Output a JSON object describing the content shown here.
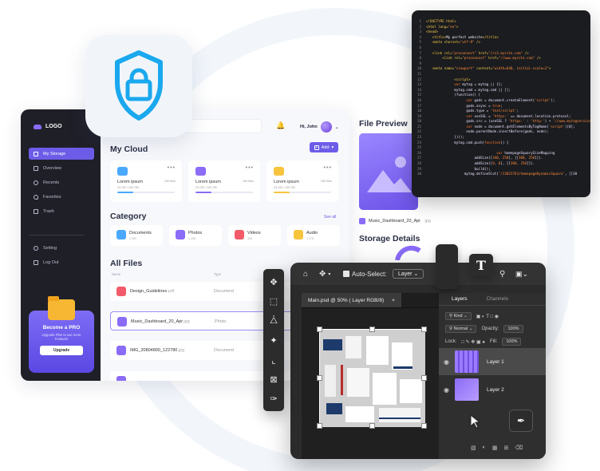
{
  "storage": {
    "logo": "LOGO",
    "nav": [
      {
        "label": "My Storage"
      },
      {
        "label": "Overview"
      },
      {
        "label": "Recents"
      },
      {
        "label": "Favorites"
      },
      {
        "label": "Trash"
      }
    ],
    "nav_bottom": [
      {
        "label": "Setting"
      },
      {
        "label": "Log Out"
      }
    ],
    "promo": {
      "title": "Become a PRO",
      "subtitle": "Upgrade Plan to use more Features",
      "button": "Upgrade"
    },
    "user_greeting": "Hi, John",
    "my_cloud_title": "My Cloud",
    "add_label": "Add",
    "cloud_cards": [
      {
        "name": "Lorem ipsum",
        "files": "150 files",
        "size": "23 GB / 100 GB",
        "progress": 0.28,
        "color": "#4aa8ff"
      },
      {
        "name": "Lorem ipsum",
        "files": "150 files",
        "size": "23 GB / 100 GB",
        "progress": 0.28,
        "color": "#8a6cf7"
      },
      {
        "name": "Lorem ipsum",
        "files": "150 files",
        "size": "23 GB / 100 GB",
        "progress": 0.28,
        "color": "#f7c43d"
      }
    ],
    "category_title": "Category",
    "see_all": "See all",
    "categories": [
      {
        "name": "Documents",
        "count": "2,350",
        "color": "#4aa8ff"
      },
      {
        "name": "Photos",
        "count": "1,156",
        "color": "#8a6cf7"
      },
      {
        "name": "Videos",
        "count": "328",
        "color": "#f25c6a"
      },
      {
        "name": "Audio",
        "count": "1,176",
        "color": "#f7c43d"
      }
    ],
    "all_files_title": "All Files",
    "columns": {
      "name": "Name",
      "type": "Type"
    },
    "files": [
      {
        "name": "Design_Guidelines",
        "ext": ".pdf",
        "type": "Document",
        "color": "#f25c6a"
      },
      {
        "name": "Music_Dashboard_20_Apr",
        "ext": ".jpg",
        "type": "Photo",
        "color": "#8a6cf7"
      },
      {
        "name": "IMG_20804800_122780",
        "ext": ".jpg",
        "type": "Document",
        "color": "#8a6cf7"
      }
    ],
    "file_preview_title": "File Preview",
    "preview_file": "Music_Dashboard_20_Apr",
    "preview_ext": ".jpg",
    "storage_details_title": "Storage Details"
  },
  "code_lines": [
    [
      [
        "tag",
        "<!DOCTYPE html>"
      ]
    ],
    [
      [
        "tag",
        "<html "
      ],
      [
        "attr",
        "lang="
      ],
      [
        "str",
        "\"en\""
      ],
      [
        "tag",
        ">"
      ]
    ],
    [
      [
        "tag",
        "<head>"
      ]
    ],
    [
      [
        "tag",
        "   <title>"
      ],
      [
        "txt",
        "My perfect website"
      ],
      [
        "tag",
        "</title>"
      ]
    ],
    [
      [
        "tag",
        "   <meta "
      ],
      [
        "attr",
        "charset="
      ],
      [
        "str",
        "\"utf-8\""
      ],
      [
        "tag",
        " />"
      ]
    ],
    [
      [
        "txt",
        ""
      ]
    ],
    [
      [
        "tag",
        "   <link "
      ],
      [
        "attr",
        "rel="
      ],
      [
        "str",
        "\"preconnect\""
      ],
      [
        "attr",
        " href="
      ],
      [
        "str",
        "\"//s3.mysite.com\""
      ],
      [
        "tag",
        " />"
      ]
    ],
    [
      [
        "tag",
        "        <link "
      ],
      [
        "attr",
        "rel="
      ],
      [
        "str",
        "\"preconnect\""
      ],
      [
        "attr",
        " href="
      ],
      [
        "str",
        "\"//www.mysite.com\""
      ],
      [
        "tag",
        " />"
      ]
    ],
    [
      [
        "txt",
        ""
      ]
    ],
    [
      [
        "tag",
        "   <meta "
      ],
      [
        "attr",
        "name="
      ],
      [
        "str",
        "\"viewport\""
      ],
      [
        "attr",
        " content="
      ],
      [
        "str",
        "\"width=640, initial-scale=1\""
      ],
      [
        "tag",
        ">"
      ]
    ],
    [
      [
        "txt",
        ""
      ]
    ],
    [
      [
        "tag",
        "              <script>"
      ]
    ],
    [
      [
        "kw",
        "              var "
      ],
      [
        "var",
        "mytag = mytag || {};"
      ]
    ],
    [
      [
        "var",
        "              mytag.cmd = mytag.cmd || [];"
      ]
    ],
    [
      [
        "var",
        "              (function() {"
      ]
    ],
    [
      [
        "kw",
        "                    var "
      ],
      [
        "var",
        "gads = document.createElement("
      ],
      [
        "str",
        "'script'"
      ],
      [
        "var",
        ");"
      ]
    ],
    [
      [
        "var",
        "                    gads.async = "
      ],
      [
        "kw",
        "true"
      ],
      [
        "var",
        ";"
      ]
    ],
    [
      [
        "var",
        "                    gads.type = "
      ],
      [
        "str",
        "'text/script'"
      ],
      [
        "var",
        ";"
      ]
    ],
    [
      [
        "kw",
        "                    var "
      ],
      [
        "var",
        "useSSL = "
      ],
      [
        "str",
        "'https:'"
      ],
      [
        "var",
        " == document.location.protocol;"
      ]
    ],
    [
      [
        "var",
        "                    gads.src = (useSSL ? "
      ],
      [
        "str",
        "'https:'"
      ],
      [
        "var",
        " : "
      ],
      [
        "str",
        "'http:'"
      ],
      [
        "var",
        ") + "
      ],
      [
        "str",
        "'//www.mytagservices"
      ]
    ],
    [
      [
        "kw",
        "                    var "
      ],
      [
        "var",
        "node = document.getElementsByTagName("
      ],
      [
        "str",
        "'script'"
      ],
      [
        "var",
        ")[0];"
      ]
    ],
    [
      [
        "var",
        "                    node.parentNode.insertBefore(gads, node);"
      ]
    ],
    [
      [
        "var",
        "              })();"
      ]
    ],
    [
      [
        "var",
        "              mytag.cmd.push("
      ],
      [
        "kw",
        "function"
      ],
      [
        "var",
        "() {"
      ]
    ],
    [
      [
        "txt",
        ""
      ]
    ],
    [
      [
        "kw",
        "                                   var "
      ],
      [
        "var",
        "homepageSquarySizeMapping"
      ]
    ],
    [
      [
        "var",
        "                        addSize(["
      ],
      [
        "str",
        "340, 250"
      ],
      [
        "var",
        "], [["
      ],
      [
        "str",
        "300, 250"
      ],
      [
        "var",
        "]])."
      ]
    ],
    [
      [
        "var",
        "                        addSize(["
      ],
      [
        "str",
        "0, 0"
      ],
      [
        "var",
        "], [["
      ],
      [
        "str",
        "300, 250"
      ],
      [
        "var",
        "]])."
      ]
    ],
    [
      [
        "var",
        "                        build();"
      ]
    ],
    [
      [
        "var",
        "                   mytag.defineSlot("
      ],
      [
        "str",
        "'/13023763/homepageDynamicSquare'"
      ],
      [
        "var",
        ", [[30"
      ]
    ]
  ],
  "photoshop": {
    "auto_select": "Auto-Select:",
    "layer_select": "Layer",
    "doc_tab": "Main.psd @ 50% ( Layer RGB/8)",
    "close": "×",
    "panel_tabs": [
      "Layers",
      "Channels"
    ],
    "kind": "Kind",
    "blend": "Normal",
    "opacity_label": "Opacity:",
    "opacity_value": "100%",
    "lock_label": "Lock:",
    "fill_label": "Fill:",
    "fill_value": "100%",
    "layers": [
      {
        "name": "Layer 1"
      },
      {
        "name": "Layer 2"
      }
    ],
    "type_tool": "T"
  },
  "icons": {
    "shield": "shield-lock-icon",
    "tools": [
      "move-icon",
      "marquee-icon",
      "lasso-icon",
      "magic-wand-icon",
      "crop-icon",
      "frame-icon",
      "eyedropper-icon"
    ]
  }
}
